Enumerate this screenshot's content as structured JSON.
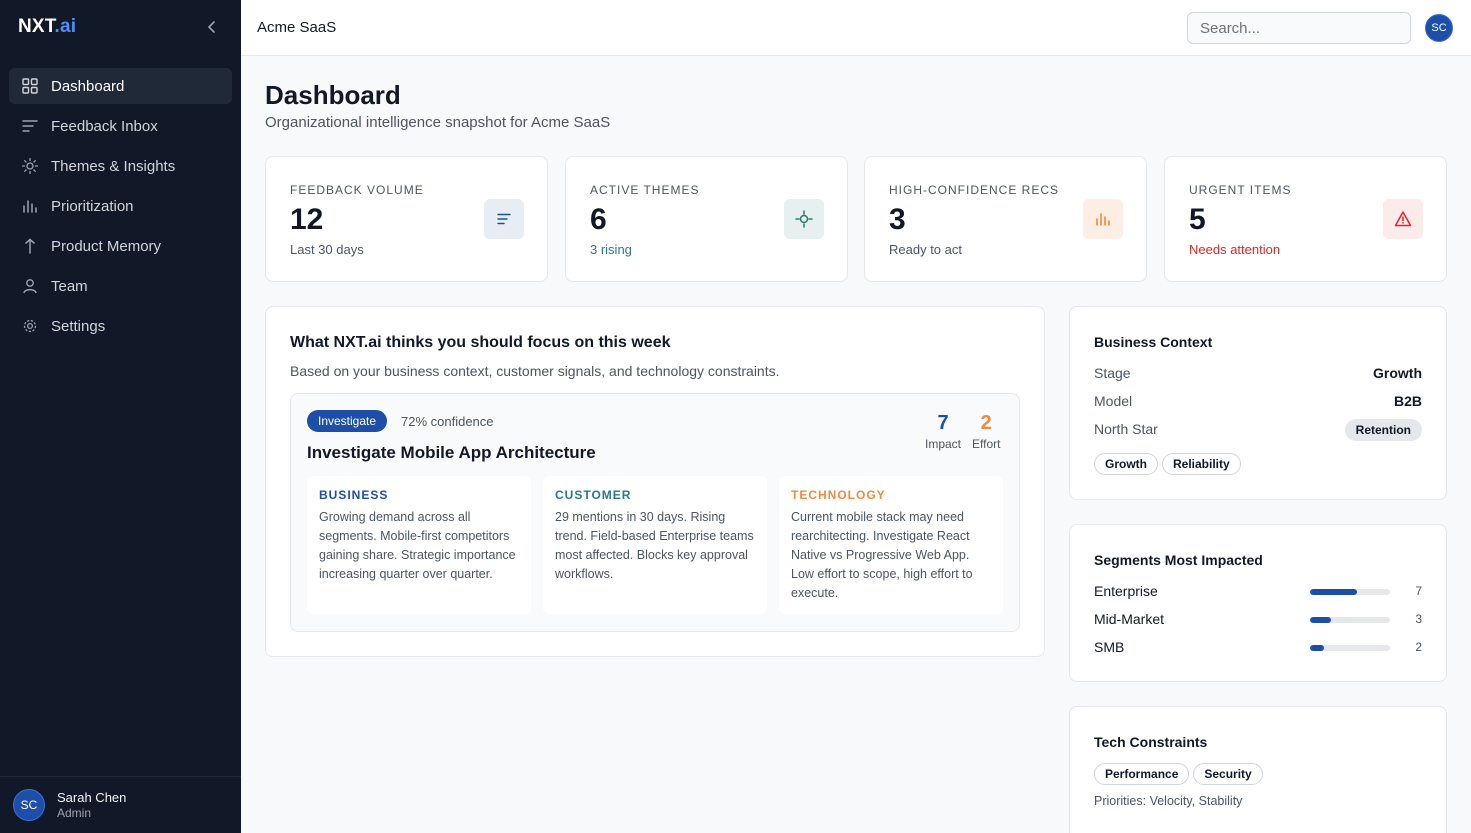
{
  "brand": {
    "name": "NXT",
    "suffix": ".ai"
  },
  "sidebar": {
    "items": [
      {
        "label": "Dashboard",
        "icon": "grid-icon",
        "active": true
      },
      {
        "label": "Feedback Inbox",
        "icon": "inbox-lines-icon"
      },
      {
        "label": "Themes & Insights",
        "icon": "sun-icon"
      },
      {
        "label": "Prioritization",
        "icon": "bar-chart-icon"
      },
      {
        "label": "Product Memory",
        "icon": "arrow-up-icon"
      },
      {
        "label": "Team",
        "icon": "user-icon"
      },
      {
        "label": "Settings",
        "icon": "gear-icon"
      }
    ],
    "user": {
      "initials": "SC",
      "name": "Sarah Chen",
      "role": "Admin"
    }
  },
  "topbar": {
    "org": "Acme SaaS",
    "search_placeholder": "Search...",
    "avatar": "SC"
  },
  "page": {
    "title": "Dashboard",
    "subtitle": "Organizational intelligence snapshot for Acme SaaS"
  },
  "stats": [
    {
      "label": "FEEDBACK VOLUME",
      "value": "12",
      "sub": "Last 30 days",
      "sub_color": "#4b5563",
      "icon": "lines-icon",
      "icon_bg": "#e8edf3",
      "icon_color": "#1e4fa8"
    },
    {
      "label": "ACTIVE THEMES",
      "value": "6",
      "sub": "3 rising",
      "sub_color": "#2a7a8c",
      "icon": "crosshair-icon",
      "icon_bg": "#e6f0ee",
      "icon_color": "#2a7a6c"
    },
    {
      "label": "HIGH-CONFIDENCE RECS",
      "value": "3",
      "sub": "Ready to act",
      "sub_color": "#4b5563",
      "icon": "bar-chart-icon",
      "icon_bg": "#fdeee3",
      "icon_color": "#f08a3c"
    },
    {
      "label": "URGENT ITEMS",
      "value": "5",
      "sub": "Needs attention",
      "sub_color": "#dc2626",
      "icon": "warning-icon",
      "icon_bg": "#fdeaea",
      "icon_color": "#dc2626"
    }
  ],
  "focus": {
    "title": "What NXT.ai thinks you should focus on this week",
    "subtitle": "Based on your business context, customer signals, and technology constraints.",
    "rec": {
      "badge": "Investigate",
      "confidence": "72% confidence",
      "title": "Investigate Mobile App Architecture",
      "impact": {
        "value": "7",
        "label": "Impact",
        "color": "#1e4fa8"
      },
      "effort": {
        "value": "2",
        "label": "Effort",
        "color": "#f08a3c"
      },
      "columns": [
        {
          "head": "BUSINESS",
          "color": "#1e4fa8",
          "text": "Growing demand across all segments. Mobile-first competitors gaining share. Strategic importance increasing quarter over quarter."
        },
        {
          "head": "CUSTOMER",
          "color": "#2a7a8c",
          "text": "29 mentions in 30 days. Rising trend. Field-based Enterprise teams most affected. Blocks key approval workflows."
        },
        {
          "head": "TECHNOLOGY",
          "color": "#f08a3c",
          "text": "Current mobile stack may need rearchitecting. Investigate React Native vs Progressive Web App. Low effort to scope, high effort to execute."
        }
      ]
    }
  },
  "business_context": {
    "title": "Business Context",
    "rows": [
      {
        "key": "Stage",
        "value": "Growth"
      },
      {
        "key": "Model",
        "value": "B2B"
      },
      {
        "key": "North Star",
        "value": "Retention"
      }
    ],
    "tags": [
      "Growth",
      "Reliability"
    ]
  },
  "segments": {
    "title": "Segments Most Impacted",
    "items": [
      {
        "name": "Enterprise",
        "count": "7",
        "fraction": 0.59
      },
      {
        "name": "Mid-Market",
        "count": "3",
        "fraction": 0.26
      },
      {
        "name": "SMB",
        "count": "2",
        "fraction": 0.17
      }
    ]
  },
  "tech": {
    "title": "Tech Constraints",
    "tags": [
      "Performance",
      "Security"
    ],
    "priorities": "Priorities: Velocity, Stability"
  }
}
